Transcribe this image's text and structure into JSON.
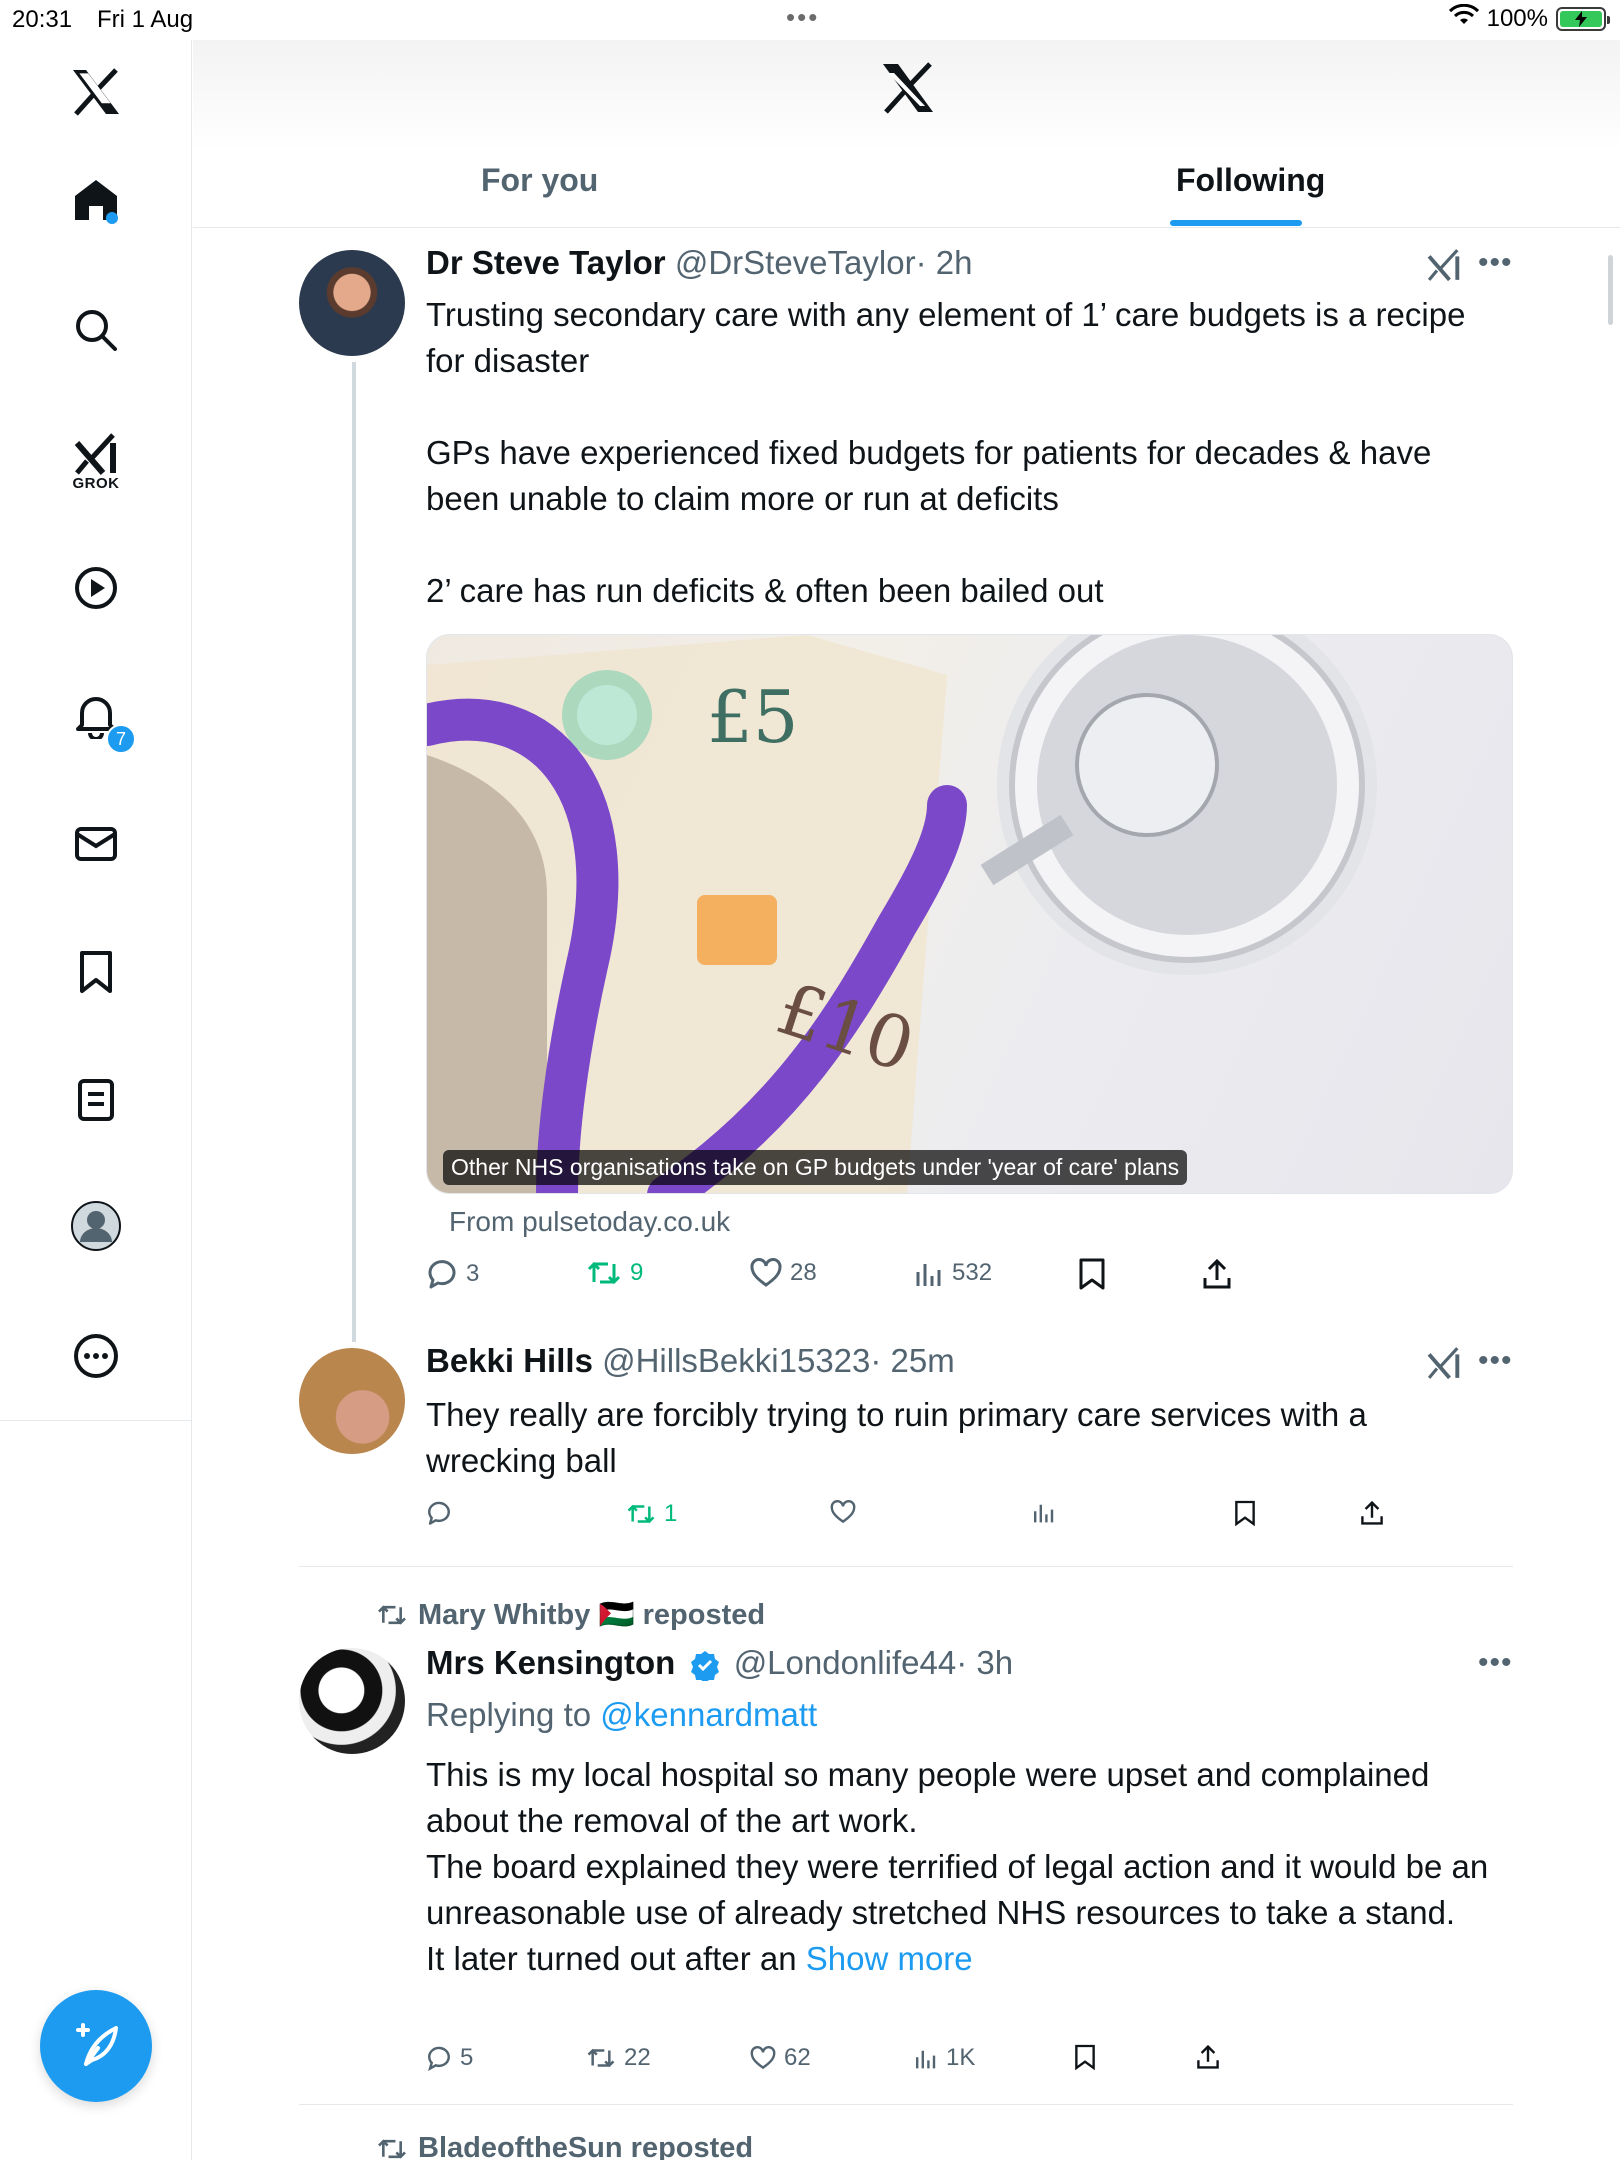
{
  "status_bar": {
    "time": "20:31",
    "date": "Fri 1 Aug",
    "battery": "100%"
  },
  "sidebar": {
    "grok_label": "GROK",
    "notifications_count": "7",
    "items": [
      "home-icon",
      "search-icon",
      "grok-icon",
      "video-icon",
      "bell-icon",
      "mail-icon",
      "bookmark-icon",
      "list-icon",
      "profile-icon",
      "more-icon"
    ]
  },
  "header": {
    "tabs": [
      {
        "label": "For you",
        "active": false
      },
      {
        "label": "Following",
        "active": true
      }
    ]
  },
  "posts": [
    {
      "name": "Dr Steve Taylor",
      "handle": "@DrSteveTaylor",
      "time": "· 2h",
      "text": "Trusting secondary care with any element of 1’ care budgets is a recipe for disaster\n\nGPs have experienced fixed budgets for patients for decades & have been unable to claim more or run at deficits\n\n2’ care has run deficits & often been bailed out",
      "card": {
        "caption": "Other NHS organisations take on GP budgets under 'year of care' plans",
        "image_text": [
          "£5",
          "£10"
        ],
        "source": "From pulsetoday.co.uk"
      },
      "stats": {
        "replies": "3",
        "reposts": "9",
        "likes": "28",
        "views": "532"
      }
    },
    {
      "name": "Bekki Hills",
      "handle": "@HillsBekki15323",
      "time": "· 25m",
      "text": "They really are forcibly trying to ruin primary care services with a wrecking ball",
      "stats": {
        "replies": "",
        "reposts": "1",
        "likes": "",
        "views": ""
      }
    },
    {
      "reposted_by": "Mary Whitby 🇵🇸 reposted",
      "name": "Mrs Kensington",
      "verified": true,
      "handle": "@Londonlife44",
      "time": "· 3h",
      "replying_prefix": "Replying to ",
      "replying_to": "@kennardmatt",
      "text": "This is my local hospital so many people were upset and complained about the removal of the art work.\nThe board explained they were terrified of legal action and it would be an unreasonable use of already stretched NHS resources to take a stand.\nIt later turned out after an ",
      "show_more": "Show more",
      "stats": {
        "replies": "5",
        "reposts": "22",
        "likes": "62",
        "views": "1K"
      }
    },
    {
      "reposted_by": "BladeoftheSun reposted"
    }
  ],
  "colors": {
    "accent": "#1d9bf0",
    "repost_green": "#00ba7c",
    "muted": "#536471"
  }
}
